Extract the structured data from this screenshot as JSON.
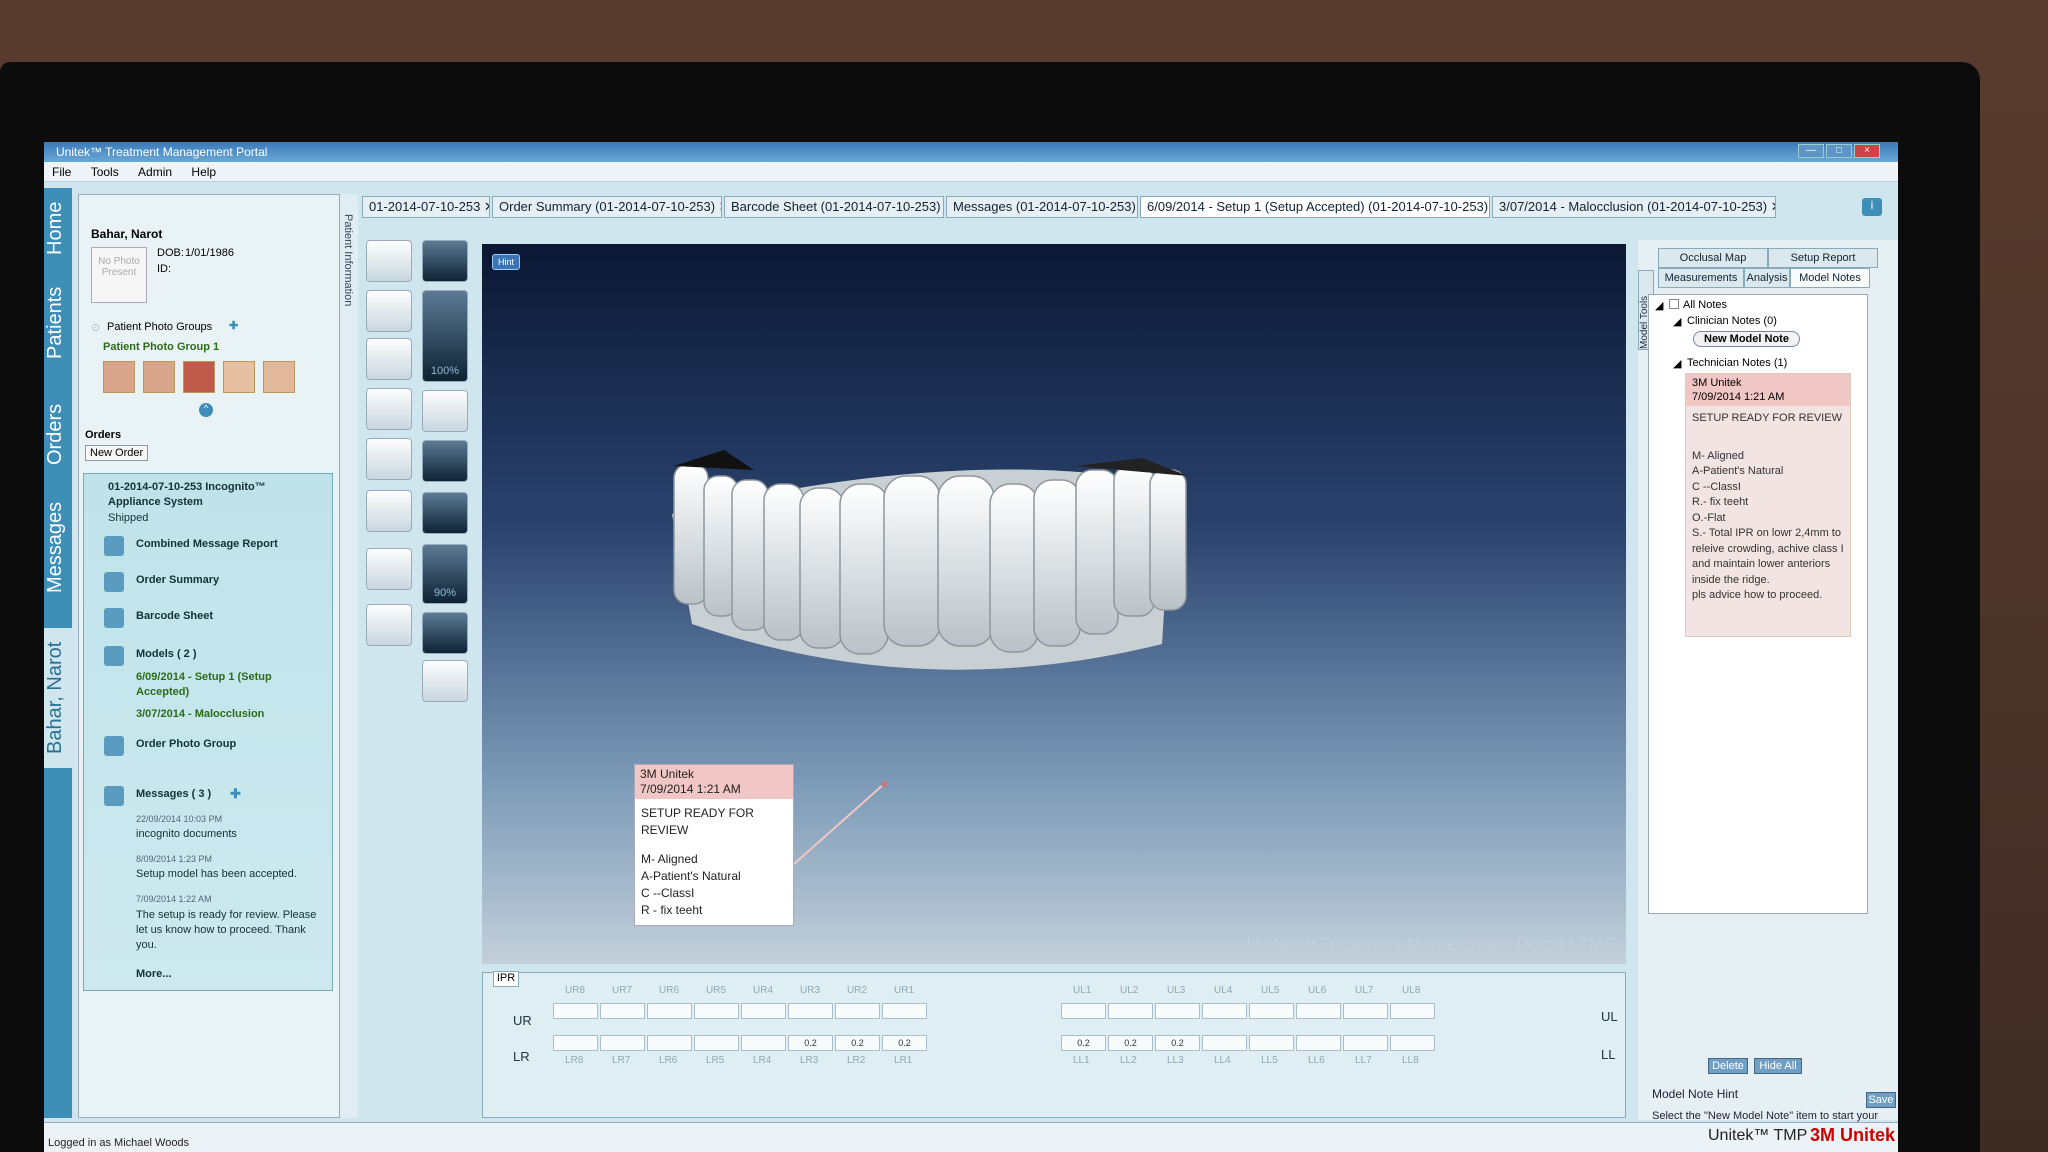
{
  "window": {
    "title": "Unitek™ Treatment Management Portal"
  },
  "menu": [
    "File",
    "Tools",
    "Admin",
    "Help"
  ],
  "nav": [
    "Home",
    "Patients",
    "Orders",
    "Messages",
    "Bahar, Narot"
  ],
  "patient": {
    "name": "Bahar, Narot",
    "dob_label": "DOB:",
    "dob": "1/01/1986",
    "id_label": "ID:",
    "no_photo": "No Photo Present",
    "photo_groups_label": "Patient Photo Groups",
    "photo_group": "Patient Photo Group 1",
    "panel_tab": "Patient Information"
  },
  "orders": {
    "label": "Orders",
    "new_order": "New Order",
    "order_id": "01-2014-07-10-253 Incognito™ Appliance System",
    "status": "Shipped",
    "items": [
      "Combined Message Report",
      "Order Summary",
      "Barcode Sheet",
      "Models ( 2 )"
    ],
    "models": [
      "6/09/2014 - Setup 1 (Setup Accepted)",
      "3/07/2014 - Malocclusion"
    ],
    "photo_group": "Order Photo Group",
    "messages_label": "Messages ( 3 )",
    "messages": [
      {
        "time": "22/09/2014 10:03 PM",
        "text": "incognito documents"
      },
      {
        "time": "8/09/2014 1:23 PM",
        "text": "Setup model has been accepted."
      },
      {
        "time": "7/09/2014 1:22 AM",
        "text": "The setup is ready for review. Please let us know how to proceed. Thank you."
      }
    ],
    "more": "More..."
  },
  "tabs": [
    "01-2014-07-10-253",
    "Order Summary (01-2014-07-10-253)",
    "Barcode Sheet (01-2014-07-10-253)",
    "Messages (01-2014-07-10-253)",
    "6/09/2014 - Setup 1 (Setup Accepted) (01-2014-07-10-253)",
    "3/07/2014 - Malocclusion (01-2014-07-10-253)"
  ],
  "viewport": {
    "hint": "Hint",
    "watermark": "Unitek™ Treatment Management Portal | TMP",
    "zoom1": "100%",
    "zoom2": "90%",
    "note": {
      "head": "3M Unitek",
      "date": "7/09/2014 1:21 AM",
      "lines": [
        "SETUP READY FOR REVIEW",
        "",
        "M- Aligned",
        "A-Patient's Natural",
        "C --ClassI",
        "R - fix teeht"
      ]
    }
  },
  "ipr": {
    "tab": "IPR",
    "upper_right": "UR",
    "lower_right": "LR",
    "upper_left": "UL",
    "lower_left": "LL",
    "ur": [
      "UR8",
      "UR7",
      "UR6",
      "UR5",
      "UR4",
      "UR3",
      "UR2",
      "UR1"
    ],
    "ul": [
      "UL1",
      "UL2",
      "UL3",
      "UL4",
      "UL5",
      "UL6",
      "UL7",
      "UL8"
    ],
    "lr": [
      "LR8",
      "LR7",
      "LR6",
      "LR5",
      "LR4",
      "LR3",
      "LR2",
      "LR1"
    ],
    "ll": [
      "LL1",
      "LL2",
      "LL3",
      "LL4",
      "LL5",
      "LL6",
      "LL7",
      "LL8"
    ],
    "lower_values_right": [
      "",
      "",
      "",
      "",
      "",
      "0.2",
      "0.2",
      "0.2"
    ],
    "lower_values_left": [
      "0.2",
      "0.2",
      "0.2",
      "",
      "",
      "",
      "",
      ""
    ]
  },
  "right": {
    "side_tab": "Model Tools",
    "tabs_top": [
      "Occlusal Map",
      "Setup Report"
    ],
    "tabs_bottom": [
      "Measurements",
      "Analysis",
      "Model Notes"
    ],
    "all_notes": "All Notes",
    "clinician": "Clinician Notes (0)",
    "new_note": "New Model Note",
    "technician": "Technician Notes (1)",
    "note": {
      "head": "3M Unitek",
      "date": "7/09/2014 1:21 AM",
      "lines": [
        "SETUP READY FOR REVIEW",
        "",
        "M- Aligned",
        "A-Patient's Natural",
        "C --ClassI",
        "R.- fix teeht",
        "O.-Flat",
        "S.- Total IPR on lowr 2,4mm to releive crowding, achive class I and maintain lower anteriors inside the ridge.",
        "pls advice how to proceed."
      ]
    },
    "delete": "Delete",
    "hide_all": "Hide All",
    "hint_title": "Model Note Hint",
    "hint_text": "Select the \"New Model Note\" item to start your model note. Click on the model to place the reference point, and then click anywhere in the viewport to place the tag. Begin typing to enter the text of your model note.",
    "save": "Save"
  },
  "status": {
    "user": "Logged in as Michael Woods",
    "brand": "Unitek™ TMP",
    "brand2": "3M Unitek"
  },
  "colors": {
    "accent": "#3d8fb8",
    "note": "#f1c7c5"
  }
}
